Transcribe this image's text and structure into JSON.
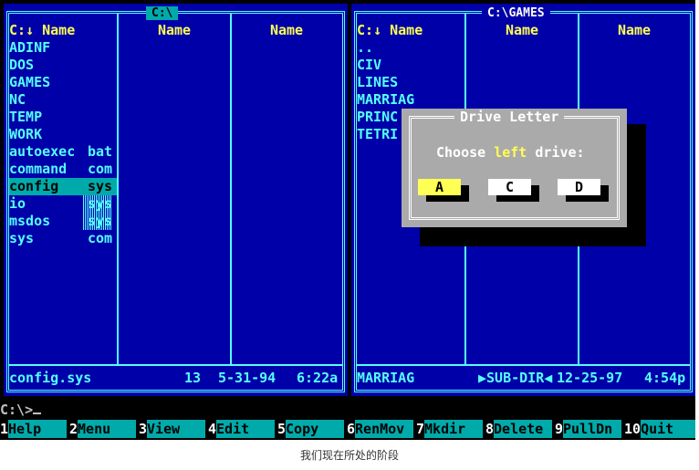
{
  "left_panel": {
    "path": "C:\\",
    "columns": [
      "C:↓ Name",
      "Name",
      "Name"
    ],
    "files": [
      {
        "name": "ADINF",
        "ext": ""
      },
      {
        "name": "DOS",
        "ext": ""
      },
      {
        "name": "GAMES",
        "ext": ""
      },
      {
        "name": "NC",
        "ext": ""
      },
      {
        "name": "TEMP",
        "ext": ""
      },
      {
        "name": "WORK",
        "ext": ""
      },
      {
        "name": "autoexec",
        "ext": "bat"
      },
      {
        "name": "command",
        "ext": "com"
      },
      {
        "name": "config",
        "ext": "sys",
        "selected": true
      },
      {
        "name": "io",
        "ext": "sys",
        "hidden": true
      },
      {
        "name": "msdos",
        "ext": "sys",
        "hidden": true
      },
      {
        "name": "sys",
        "ext": "com"
      }
    ],
    "status": {
      "name": "config.sys",
      "size": "13",
      "date": "5-31-94",
      "time": "6:22a"
    }
  },
  "right_panel": {
    "path": "C:\\GAMES",
    "columns": [
      "C:↓ Name",
      "Name",
      "Name"
    ],
    "files": [
      {
        "name": ".."
      },
      {
        "name": "CIV"
      },
      {
        "name": "LINES"
      },
      {
        "name": "MARRIAG"
      },
      {
        "name": "PRINC"
      },
      {
        "name": "TETRI"
      }
    ],
    "status": {
      "name": "MARRIAG",
      "size": "▶SUB-DIR◀",
      "date": "12-25-97",
      "time": "4:54p"
    }
  },
  "dialog": {
    "title": "Drive Letter",
    "prompt_before": "Choose ",
    "prompt_highlight": "left",
    "prompt_after": " drive:",
    "buttons": [
      "A",
      "C",
      "D"
    ],
    "focused": "A"
  },
  "command_line": {
    "prompt": "C:\\>"
  },
  "keybar": [
    {
      "num": "1",
      "label": "Help"
    },
    {
      "num": "2",
      "label": "Menu"
    },
    {
      "num": "3",
      "label": "View"
    },
    {
      "num": "4",
      "label": "Edit"
    },
    {
      "num": "5",
      "label": "Copy"
    },
    {
      "num": "6",
      "label": "RenMov"
    },
    {
      "num": "7",
      "label": "Mkdir"
    },
    {
      "num": "8",
      "label": "Delete"
    },
    {
      "num": "9",
      "label": "PullDn"
    },
    {
      "num": "10",
      "label": "Quit"
    }
  ],
  "caption": "我们现在所处的阶段",
  "colors": {
    "panel": "#0000a8",
    "text": "#55ffff",
    "header": "#ffff55",
    "dialog": "#aaaaaa",
    "highlight": "#00aaaa"
  }
}
